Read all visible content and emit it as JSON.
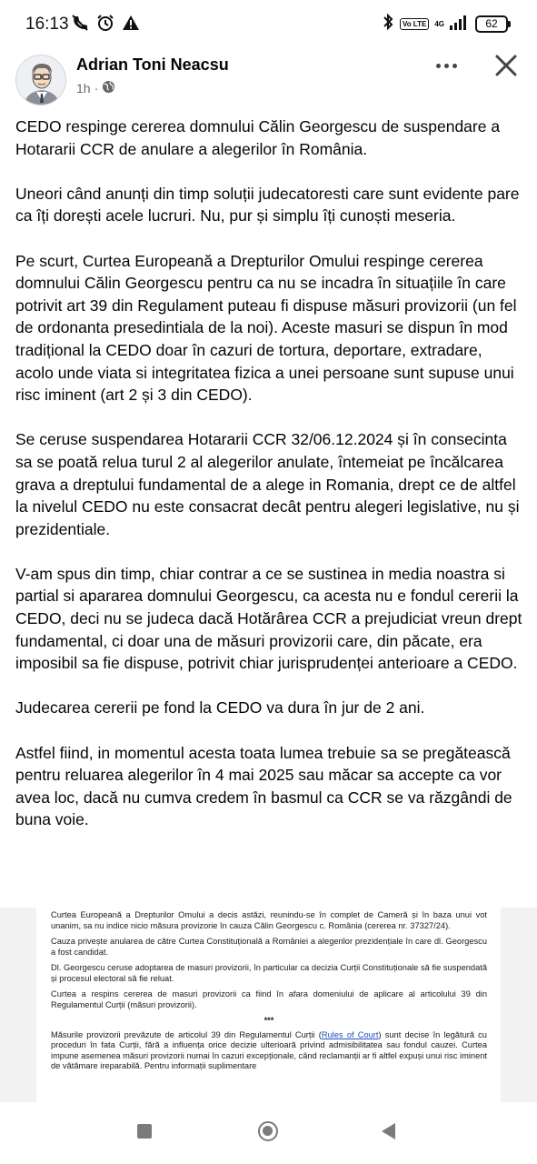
{
  "status_bar": {
    "time": "16:13",
    "left_icons": [
      "muted-call-icon",
      "alarm-icon",
      "warning-icon"
    ],
    "right_icons": [
      "bluetooth-icon",
      "volte-icon",
      "signal-icon",
      "battery-icon"
    ],
    "volte_label": "Vo LTE",
    "network_label": "4G",
    "battery_level": "62"
  },
  "post": {
    "author": "Adrian Toni Neacsu",
    "time_ago": "1h",
    "meta_separator": "·",
    "privacy_icon": "globe-icon",
    "paragraphs": [
      "CEDO respinge cererea domnului Călin Georgescu de suspendare a Hotararii CCR de anulare a alegerilor în România.",
      "Uneori când anunți din timp soluții judecatoresti care sunt evidente pare ca îți dorești acele lucruri. Nu, pur și simplu îți cunoști meseria.",
      "Pe scurt, Curtea Europeană a Drepturilor Omului respinge cererea domnului Călin Georgescu pentru ca nu se incadra în situațiile în care potrivit art 39 din Regulament puteau fi dispuse măsuri provizorii (un fel de ordonanta presedintiala de la noi). Aceste masuri se dispun în mod tradițional la CEDO doar în cazuri de tortura, deportare, extradare, acolo unde viata si integritatea fizica a unei persoane sunt supuse unui risc iminent (art 2 și 3 din CEDO).",
      "Se ceruse suspendarea Hotararii CCR 32/06.12.2024 și în consecinta sa se poată relua turul 2 al alegerilor anulate, întemeiat pe încălcarea grava a dreptului fundamental de a alege in Romania, drept ce de altfel la nivelul CEDO nu este consacrat decât pentru alegeri legislative, nu și prezidentiale.",
      "V-am spus din timp, chiar contrar a ce se sustinea in media noastra si partial si apararea domnului Georgescu, ca acesta nu e fondul cererii la CEDO, deci nu se judeca dacă Hotărârea CCR a prejudiciat vreun drept fundamental, ci doar una de măsuri provizorii care, din păcate, era imposibil sa fie dispuse, potrivit chiar jurisprudenței anterioare a CEDO.",
      "Judecarea cererii pe fond la CEDO va dura în jur de 2 ani.",
      "Astfel fiind, in momentul acesta toata lumea trebuie sa se pregătească pentru reluarea alegerilor în 4 mai 2025 sau măcar sa accepte ca vor avea loc, dacă nu cumva credem în basmul ca CCR se va răzgândi de buna voie."
    ]
  },
  "document_image": {
    "paragraphs": [
      "Curtea Europeană a Drepturilor Omului a decis astăzi, reunindu-se în complet de Cameră și în baza unui vot unanim, sa nu indice nicio măsura provizorie în cauza Călin Georgescu c. România (cererea nr. 37327/24).",
      "Cauza privește anularea de către Curtea Constituțională a României a alegerilor prezidențiale în care dl. Georgescu a fost candidat.",
      "Dl. Georgescu ceruse adoptarea de masuri provizorii, în particular ca decizia Curții Constituționale să fie suspendată și procesul electoral să fie reluat.",
      "Curtea a respins cererea de masuri provizorii ca fiind în afara domeniului de aplicare al articolului 39 din Regulamentul Curții (măsuri provizorii)."
    ],
    "separator": "***",
    "last_paragraph_before_link": "Măsurile provizorii prevăzute de articolul 39 din Regulamentul Curții (",
    "link_text": "Rules of Court",
    "last_paragraph_after_link": ") sunt decise în legătură cu proceduri în fata Curții, fără a influența orice decizie ulterioară privind admisibilitatea sau fondul cauzei. Curtea impune asemenea măsuri provizorii numai în cazuri excepționale, când reclamanții ar fi altfel expuși unui risc iminent de vătămare ireparabilă. Pentru informații suplimentare"
  },
  "nav_bar": {
    "buttons": [
      "recents-button",
      "home-button",
      "back-button"
    ]
  }
}
